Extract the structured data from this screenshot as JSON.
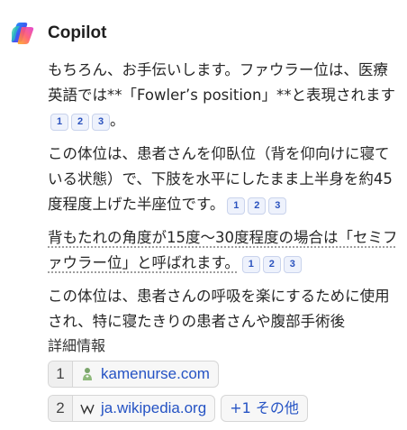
{
  "header": {
    "app_name": "Copilot"
  },
  "message": {
    "paragraphs": [
      {
        "text": "もちろん、お手伝いします。ファウラー位は、医療英語では**「Fowler’s position」**と表現されます",
        "citations": [
          "1",
          "2",
          "3"
        ],
        "suffix": "。"
      },
      {
        "text": "この体位は、患者さんを仰臥位（背を仰向けに寝ている状態）で、下肢を水平にしたまま上半身を約45度程度上げた半座位です。",
        "citations": [
          "1",
          "2",
          "3"
        ],
        "suffix": ""
      },
      {
        "text": "背もたれの角度が15度～30度程度の場合は「セミファウラー位」と呼ばれます。",
        "citations": [
          "1",
          "2",
          "3"
        ],
        "suffix": ""
      },
      {
        "text": "この体位は、患者さんの呼吸を楽にするために使用され、特に寝たきりの患者さんや腹部手術後",
        "citations": [],
        "suffix": ""
      }
    ]
  },
  "details": {
    "label": "詳細情報",
    "sources": [
      {
        "num": "1",
        "domain": "kamenurse.com",
        "icon": "nurse-favicon-icon"
      },
      {
        "num": "2",
        "domain": "ja.wikipedia.org",
        "icon": "wikipedia-w-icon"
      }
    ],
    "more_label": "+1 その他"
  }
}
